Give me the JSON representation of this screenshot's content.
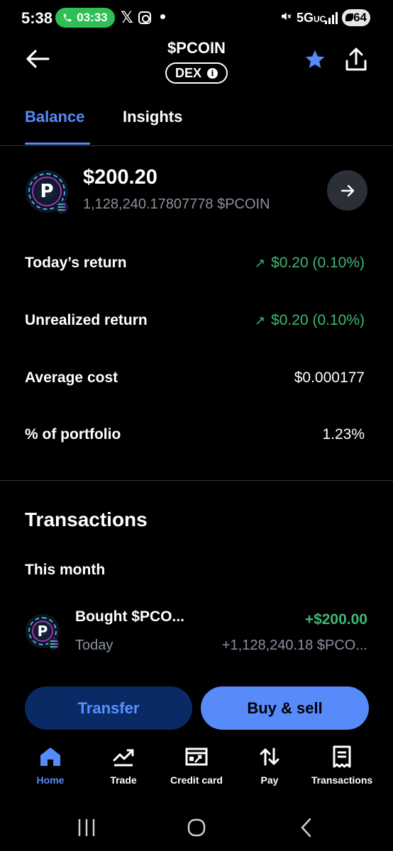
{
  "status_bar": {
    "time": "5:38",
    "call_timer": "03:33",
    "network": "5G",
    "network_suffix": "UC",
    "battery": "64"
  },
  "header": {
    "title": "$PCOIN",
    "badge": "DEX",
    "accent_color": "#578bfa"
  },
  "tabs": [
    {
      "label": "Balance",
      "active": true
    },
    {
      "label": "Insights",
      "active": false
    }
  ],
  "balance": {
    "usd": "$200.20",
    "coin_amount": "1,128,240.17807778 $PCOIN"
  },
  "stats": [
    {
      "label": "Today’s return",
      "value": "$0.20 (0.10%)",
      "positive": true
    },
    {
      "label": "Unrealized return",
      "value": "$0.20 (0.10%)",
      "positive": true
    },
    {
      "label": "Average cost",
      "value": "$0.000177",
      "positive": false
    },
    {
      "label": "% of portfolio",
      "value": "1.23%",
      "positive": false
    }
  ],
  "transactions": {
    "title": "Transactions",
    "month": "This month",
    "items": [
      {
        "title": "Bought $PCO...",
        "date": "Today",
        "amount": "+$200.00",
        "coin": "+1,128,240.18 $PCO..."
      }
    ]
  },
  "actions": {
    "transfer": "Transfer",
    "buy_sell": "Buy & sell"
  },
  "bottom_nav": [
    {
      "label": "Home",
      "icon": "home-icon",
      "active": true
    },
    {
      "label": "Trade",
      "icon": "trend-up-icon",
      "active": false
    },
    {
      "label": "Credit card",
      "icon": "credit-card-icon",
      "active": false
    },
    {
      "label": "Pay",
      "icon": "swap-arrows-icon",
      "active": false
    },
    {
      "label": "Transactions",
      "icon": "receipt-icon",
      "active": false
    }
  ],
  "colors": {
    "positive": "#3fb676",
    "muted": "#8a919e",
    "transfer_bg": "#0a2a66",
    "buy_bg": "#578bfa"
  }
}
